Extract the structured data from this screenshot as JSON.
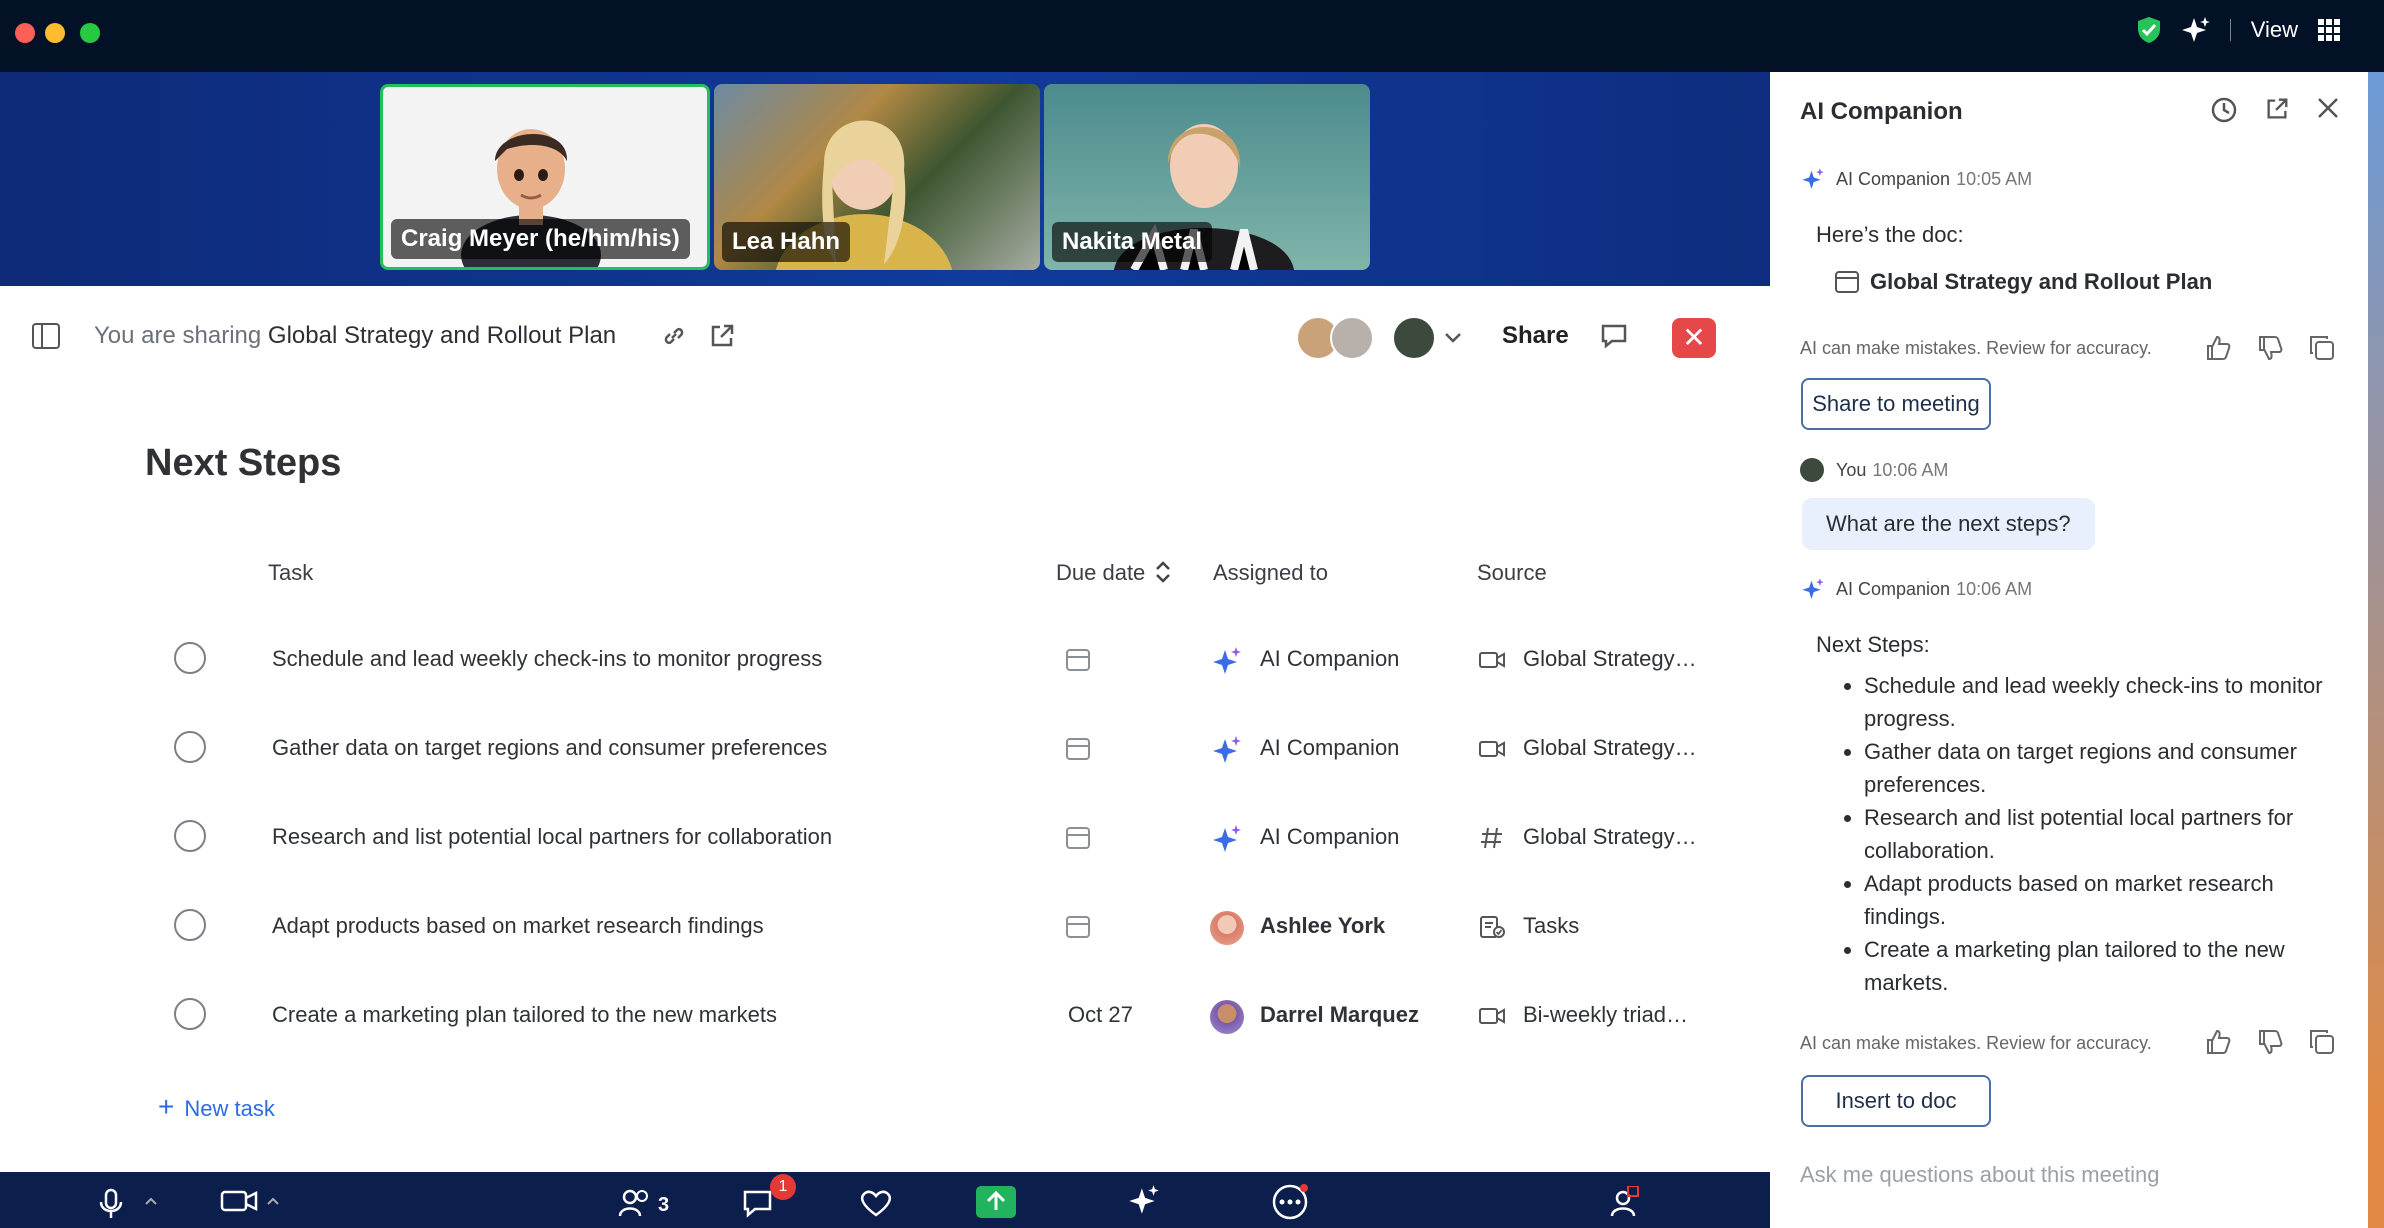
{
  "top": {
    "view_label": "View"
  },
  "stage": {
    "participants": [
      {
        "name": "Craig Meyer (he/him/his)"
      },
      {
        "name": "Lea Hahn"
      },
      {
        "name": "Nakita Metal"
      }
    ]
  },
  "sharebar": {
    "prefix": "You are sharing",
    "doc_title": "Global Strategy and Rollout Plan",
    "share_label": "Share"
  },
  "doc": {
    "heading": "Next Steps",
    "columns": {
      "task": "Task",
      "due": "Due date",
      "assigned": "Assigned to",
      "source": "Source"
    },
    "rows": [
      {
        "task": "Schedule and lead weekly check-ins to monitor progress",
        "due": "",
        "assignee": "AI Companion",
        "assignee_type": "ai",
        "source_icon": "video-icon",
        "source": "Global Strategy…"
      },
      {
        "task": "Gather data on target regions and consumer preferences",
        "due": "",
        "assignee": "AI Companion",
        "assignee_type": "ai",
        "source_icon": "video-icon",
        "source": "Global Strategy…"
      },
      {
        "task": "Research and list potential local partners for collaboration",
        "due": "",
        "assignee": "AI Companion",
        "assignee_type": "ai",
        "source_icon": "hash-icon",
        "source": "Global Strategy…"
      },
      {
        "task": "Adapt products based on market research findings",
        "due": "",
        "assignee": "Ashlee York",
        "assignee_type": "person",
        "source_icon": "tasks-icon",
        "source": "Tasks"
      },
      {
        "task": "Create a marketing plan tailored to the new markets",
        "due": "Oct 27",
        "assignee": "Darrel Marquez",
        "assignee_type": "person",
        "source_icon": "video-icon",
        "source": "Bi-weekly triad…"
      }
    ],
    "new_task": "New task"
  },
  "panel": {
    "title": "AI Companion",
    "msg1": {
      "sender": "AI Companion",
      "time": "10:05 AM",
      "text": "Here’s the doc:",
      "doc": "Global Strategy and Rollout Plan"
    },
    "warning": "AI can make mistakes. Review for accuracy.",
    "share_button": "Share to meeting",
    "msg2": {
      "sender": "You",
      "time": "10:06 AM",
      "text": "What are the next steps?"
    },
    "msg3": {
      "sender": "AI Companion",
      "time": "10:06 AM",
      "title": "Next Steps:",
      "items": [
        "Schedule and lead weekly check-ins to monitor progress.",
        "Gather data on target regions and consumer preferences.",
        "Research and list potential local partners for collaboration.",
        "Adapt products based on market research findings.",
        "Create a marketing plan tailored to the new markets."
      ]
    },
    "insert_button": "Insert to doc",
    "ask_placeholder": "Ask me questions about this meeting"
  },
  "bottombar": {
    "participants_count": "3",
    "chat_badge": "1"
  }
}
